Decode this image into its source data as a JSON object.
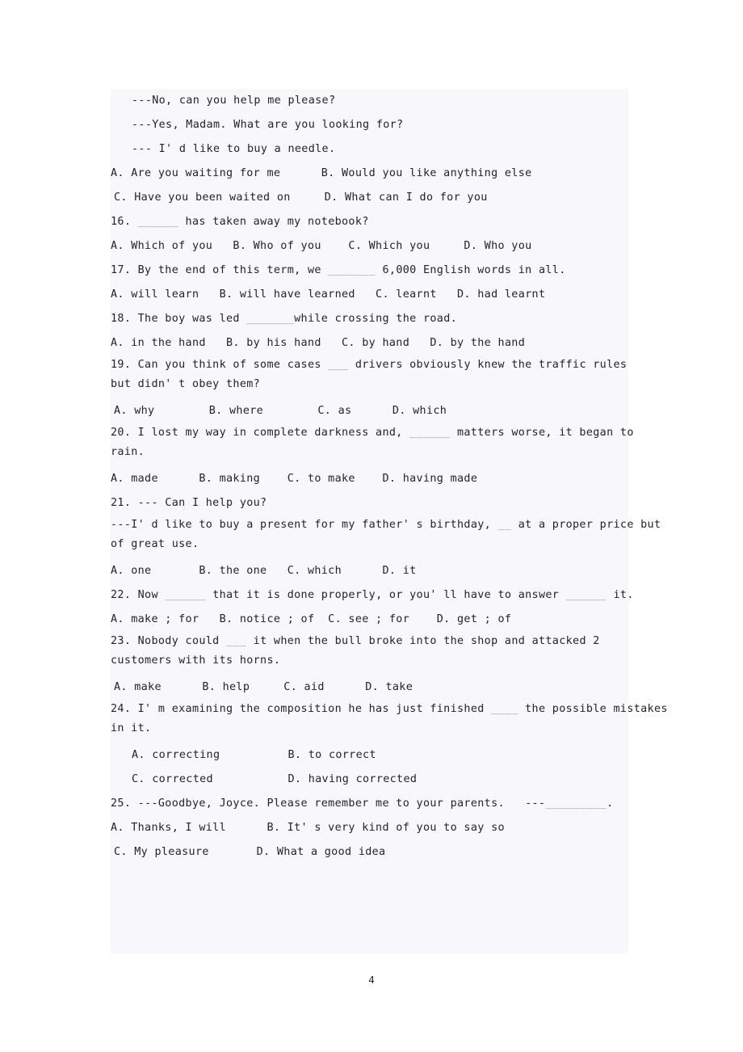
{
  "page": {
    "number": "4",
    "tint_color": "#f7f7fc",
    "text_color": "#242424",
    "blank_color": "#8e8e96"
  },
  "lines": [
    {
      "indent": 3,
      "text": "---No, can you help me please?"
    },
    {
      "indent": 3,
      "text": "---Yes, Madam. What are you looking for?"
    },
    {
      "indent": 3,
      "text": "--- I' d like to buy a needle."
    },
    {
      "indent": 0,
      "text": "A. Are you waiting for me      B. Would you like anything else"
    },
    {
      "indent": 1,
      "text": "C. Have you been waited on     D. What can I do for you"
    },
    {
      "indent": 0,
      "pre": "16. ",
      "blank": "______",
      "post": " has taken away my notebook?"
    },
    {
      "indent": 0,
      "text": "A. Which of you   B. Who of you    C. Which you     D. Who you"
    },
    {
      "indent": 0,
      "pre": "17. By the end of this term, we ",
      "blank": "_______",
      "post": " 6,000 English words in all."
    },
    {
      "indent": 0,
      "text": "A. will learn   B. will have learned   C. learnt   D. had learnt"
    },
    {
      "indent": 0,
      "pre": "18. The boy was led ",
      "blank": "_______",
      "post": "while crossing the road."
    },
    {
      "indent": 0,
      "text": "A. in the hand   B. by his hand   C. by hand   D. by the hand"
    },
    {
      "indent": 0,
      "wrap": true,
      "pre": "19. Can you think of some cases ",
      "blank": "___",
      "post": " drivers obviously knew the traffic rules",
      "cont": "but didn' t obey them?"
    },
    {
      "indent": 1,
      "text": "A. why        B. where        C. as      D. which"
    },
    {
      "indent": 0,
      "wrap": true,
      "pre": "20. I lost my way in complete darkness and, ",
      "blank": "______",
      "post": " matters worse, it began to",
      "cont": "rain."
    },
    {
      "indent": 0,
      "text": "A. made      B. making    C. to make    D. having made"
    },
    {
      "indent": 0,
      "text": "21. --- Can I help you?"
    },
    {
      "indent": 0,
      "wrap": true,
      "pre": "---I' d like to buy a present for my father' s birthday, ",
      "blank": "__",
      "post": " at a proper price but",
      "cont": "of great use."
    },
    {
      "indent": 0,
      "text": "A. one       B. the one   C. which      D. it"
    },
    {
      "indent": 0,
      "pre": "22. Now ",
      "blank": "______",
      "post": " that it is done properly, or you' ll have to answer ",
      "blank2": "______",
      "post2": " it."
    },
    {
      "indent": 0,
      "text": "A. make ; for   B. notice ; of  C. see ; for    D. get ; of"
    },
    {
      "indent": 0,
      "wrap": true,
      "pre": "23. Nobody could ",
      "blank": "___",
      "post": " it when the bull broke into the shop and attacked 2",
      "cont": "customers with its horns."
    },
    {
      "indent": 1,
      "text": "A. make      B. help     C. aid      D. take"
    },
    {
      "indent": 0,
      "wrap": true,
      "pre": "24. I' m examining the composition he has just finished ",
      "blank": "____",
      "post": " the possible mistakes",
      "cont": "in it."
    },
    {
      "indent": 3,
      "text": "A. correcting          B. to correct"
    },
    {
      "indent": 3,
      "text": "C. corrected           D. having corrected"
    },
    {
      "indent": 0,
      "pre": "25. ---Goodbye, Joyce. Please remember me to your parents.   ---",
      "blank": "_________",
      "post": "."
    },
    {
      "indent": 0,
      "text": "A. Thanks, I will      B. It' s very kind of you to say so"
    },
    {
      "indent": 1,
      "text": "C. My pleasure       D. What a good idea"
    }
  ]
}
